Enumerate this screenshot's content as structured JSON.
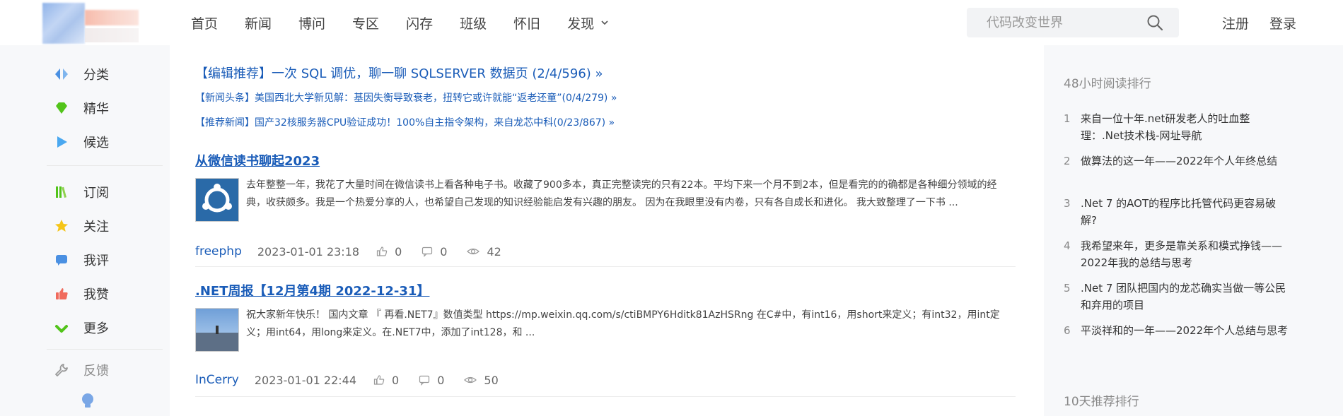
{
  "header": {
    "nav": [
      "首页",
      "新闻",
      "博问",
      "专区",
      "闪存",
      "班级",
      "怀旧",
      "发现"
    ],
    "search_placeholder": "代码改变世界",
    "register": "注册",
    "login": "登录"
  },
  "sidebar": {
    "items": [
      {
        "label": "分类",
        "icon": "category-icon",
        "color": "#4a90e2"
      },
      {
        "label": "精华",
        "icon": "gem-icon",
        "color": "#52c41a"
      },
      {
        "label": "候选",
        "icon": "play-icon",
        "color": "#4aa8f0"
      },
      {
        "label": "订阅",
        "icon": "books-icon",
        "color": "#52c41a"
      },
      {
        "label": "关注",
        "icon": "star-icon",
        "color": "#f5c518"
      },
      {
        "label": "我评",
        "icon": "comment-icon",
        "color": "#4a90e2"
      },
      {
        "label": "我赞",
        "icon": "thumb-up-icon",
        "color": "#f06b5d"
      },
      {
        "label": "更多",
        "icon": "check-icon",
        "color": "#52c41a"
      },
      {
        "label": "反馈",
        "icon": "wrench-icon",
        "color": "#999999"
      }
    ]
  },
  "main": {
    "rec1": "【编辑推荐】一次 SQL 调优，聊一聊 SQLSERVER 数据页 (2/4/596) »",
    "rec2": "【新闻头条】美国西北大学新见解：基因失衡导致衰老，扭转它或许就能“返老还童”(0/4/279) »",
    "rec3": "【推荐新闻】国产32核服务器CPU验证成功！100%自主指令架构，来自龙芯中科(0/23/867) »",
    "posts": [
      {
        "title": "从微信读书聊起2023",
        "summary": "去年整整一年，我花了大量时间在微信读书上看各种电子书。收藏了900多本，真正完整读完的只有22本。平均下来一个月不到2本，但是看完的的确都是各种细分领域的经典，收获颇多。我是一个热爱分享的人，也希望自己发现的知识经验能启发有兴趣的朋友。 因为在我眼里没有内卷，只有各自成长和进化。 我大致整理了一下书 ...",
        "author": "freephp",
        "date": "2023-01-01 23:18",
        "likes": "0",
        "comments": "0",
        "views": "42"
      },
      {
        "title": ".NET周报【12月第4期 2022-12-31】",
        "summary": "祝大家新年快乐！ 国内文章 『 再看.NET7』数值类型 https://mp.weixin.qq.com/s/ctiBMPY6Hditk81AzHSRng 在C#中，有int16，用short来定义；有int32，用int定义；用int64，用long来定义。在.NET7中，添加了int128，和 ...",
        "author": "InCerry",
        "date": "2023-01-01 22:44",
        "likes": "0",
        "comments": "0",
        "views": "50"
      }
    ]
  },
  "right": {
    "rank_title": "48小时阅读排行",
    "items": [
      {
        "num": "1",
        "text": "来自一位十年.net研发老人的吐血整理：.Net技术栈-网址导航"
      },
      {
        "num": "2",
        "text": "做算法的这一年——2022年个人年终总结"
      },
      {
        "num": "3",
        "text": ".Net 7 的AOT的程序比托管代码更容易破解?"
      },
      {
        "num": "4",
        "text": "我希望来年，更多是靠关系和模式挣钱——2022年我的总结与思考"
      },
      {
        "num": "5",
        "text": ".Net 7 团队把国内的龙芯确实当做一等公民和弃用的项目"
      },
      {
        "num": "6",
        "text": "平淡祥和的一年——2022年个人总结与思考"
      }
    ],
    "rank_title2": "10天推荐排行"
  }
}
